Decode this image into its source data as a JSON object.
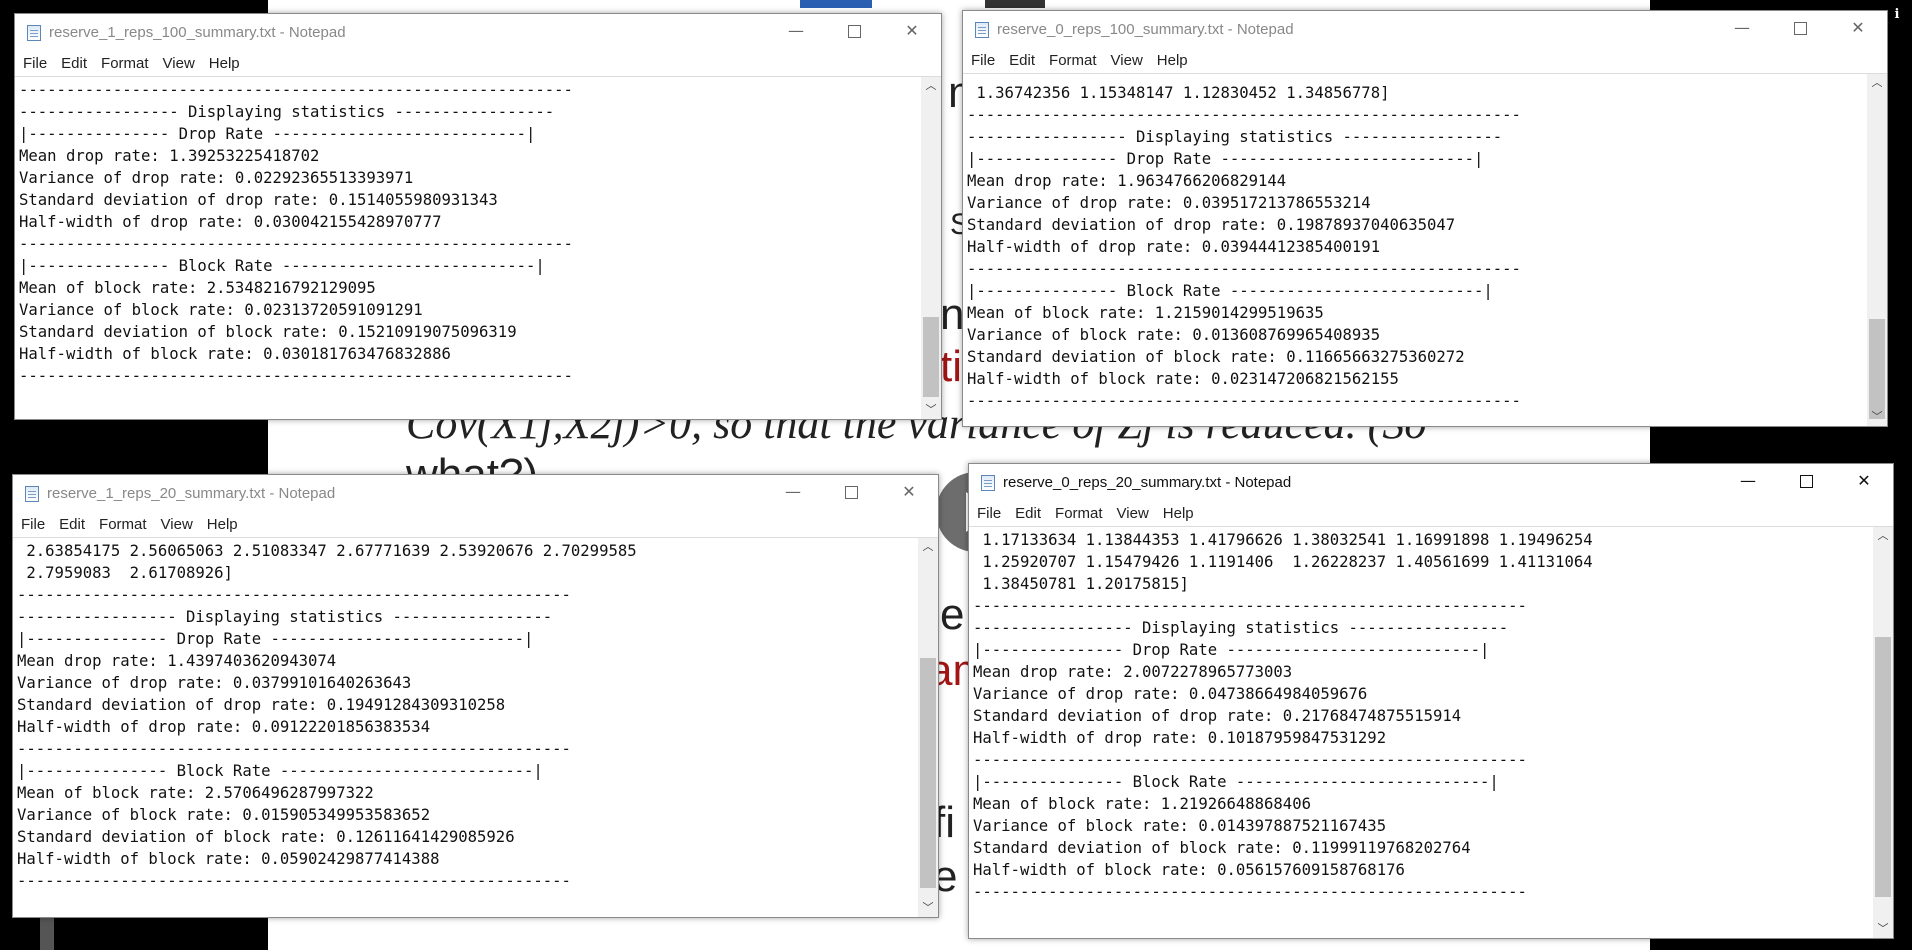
{
  "menu": [
    "File",
    "Edit",
    "Format",
    "View",
    "Help"
  ],
  "background": {
    "fragments": [
      {
        "text": "m"
      },
      {
        "text": "S"
      },
      {
        "text": "ne"
      },
      {
        "text": "ti"
      },
      {
        "text": "Cov(X1j,X2j)>0, so that the variance of Zj is reduced. (So"
      },
      {
        "text": "what?)"
      },
      {
        "text": "e v"
      },
      {
        "text": "am"
      },
      {
        "text": "fi"
      },
      {
        "text": "e"
      }
    ]
  },
  "windows": [
    {
      "title": "reserve_1_reps_100_summary.txt - Notepad",
      "lines": [
        "-----------------------------------------------------------",
        "----------------- Displaying statistics -----------------",
        "|--------------- Drop Rate ---------------------------|",
        "Mean drop rate: 1.39253225418702",
        "Variance of drop rate: 0.02292365513393971",
        "Standard deviation of drop rate: 0.1514055980931343",
        "Half-width of drop rate: 0.030042155428970777",
        "-----------------------------------------------------------",
        "|--------------- Block Rate ---------------------------|",
        "Mean of block rate: 2.5348216792129095",
        "Variance of block rate: 0.02313720591091291",
        "Standard deviation of block rate: 0.15210919075096319",
        "Half-width of block rate: 0.030181763476832886",
        "-----------------------------------------------------------"
      ]
    },
    {
      "title": "reserve_0_reps_100_summary.txt - Notepad",
      "lines": [
        " 1.36742356 1.15348147 1.12830452 1.34856778]",
        "-----------------------------------------------------------",
        "----------------- Displaying statistics -----------------",
        "|--------------- Drop Rate ---------------------------|",
        "Mean drop rate: 1.9634766206829144",
        "Variance of drop rate: 0.039517213786553214",
        "Standard deviation of drop rate: 0.19878937040635047",
        "Half-width of drop rate: 0.03944412385400191",
        "-----------------------------------------------------------",
        "|--------------- Block Rate ---------------------------|",
        "Mean of block rate: 1.2159014299519635",
        "Variance of block rate: 0.013608769965408935",
        "Standard deviation of block rate: 0.11665663275360272",
        "Half-width of block rate: 0.023147206821562155",
        "-----------------------------------------------------------"
      ]
    },
    {
      "title": "reserve_1_reps_20_summary.txt - Notepad",
      "lines": [
        " 2.63854175 2.56065063 2.51083347 2.67771639 2.53920676 2.70299585",
        " 2.7959083  2.61708926]",
        "-----------------------------------------------------------",
        "----------------- Displaying statistics -----------------",
        "|--------------- Drop Rate ---------------------------|",
        "Mean drop rate: 1.4397403620943074",
        "Variance of drop rate: 0.03799101640263643",
        "Standard deviation of drop rate: 0.19491284309310258",
        "Half-width of drop rate: 0.09122201856383534",
        "-----------------------------------------------------------",
        "|--------------- Block Rate ---------------------------|",
        "Mean of block rate: 2.5706496287997322",
        "Variance of block rate: 0.015905349953583652",
        "Standard deviation of block rate: 0.12611641429085926",
        "Half-width of block rate: 0.05902429877414388",
        "-----------------------------------------------------------"
      ]
    },
    {
      "title": "reserve_0_reps_20_summary.txt - Notepad",
      "lines": [
        " 1.17133634 1.13844353 1.41796626 1.38032541 1.16991898 1.19496254",
        " 1.25920707 1.15479426 1.1191406  1.26228237 1.40561699 1.41131064",
        " 1.38450781 1.20175815]",
        "-----------------------------------------------------------",
        "----------------- Displaying statistics -----------------",
        "|--------------- Drop Rate ---------------------------|",
        "Mean drop rate: 2.0072278965773003",
        "Variance of drop rate: 0.04738664984059676",
        "Standard deviation of drop rate: 0.21768474875515914",
        "Half-width of drop rate: 0.10187959847531292",
        "-----------------------------------------------------------",
        "|--------------- Block Rate ---------------------------|",
        "Mean of block rate: 1.21926648868406",
        "Variance of block rate: 0.014397887521167435",
        "Standard deviation of block rate: 0.11999119768202764",
        "Half-width of block rate: 0.056157609158768176",
        "-----------------------------------------------------------"
      ]
    }
  ]
}
